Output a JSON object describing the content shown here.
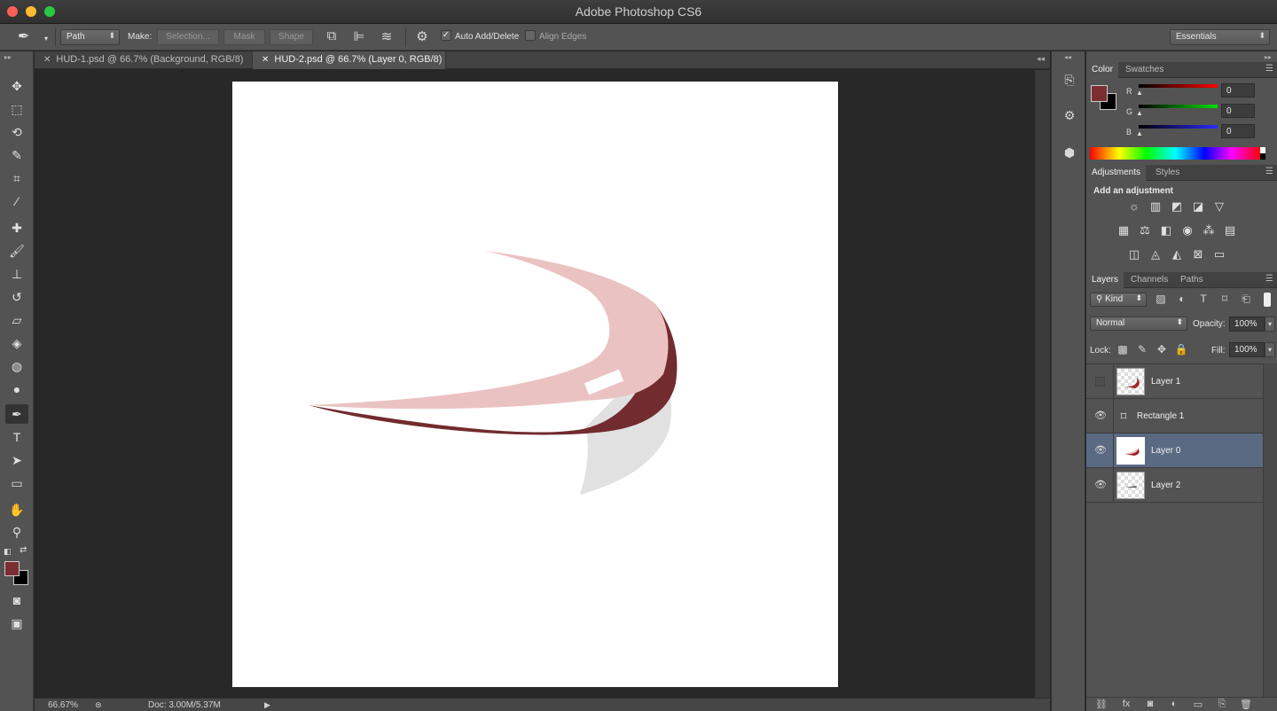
{
  "window": {
    "title": "Adobe Photoshop CS6"
  },
  "options_bar": {
    "mode_select": "Path",
    "make_label": "Make:",
    "selection_button": "Selection...",
    "mask_button": "Mask",
    "shape_button": "Shape",
    "auto_add_delete_label": "Auto Add/Delete",
    "auto_add_delete_checked": "✓",
    "align_edges_label": "Align Edges",
    "workspace_select": "Essentials"
  },
  "doc_tabs": [
    {
      "label": "HUD-1.psd @ 66.7% (Background, RGB/8)",
      "active": false
    },
    {
      "label": "HUD-2.psd @ 66.7% (Layer 0, RGB/8)",
      "active": true
    }
  ],
  "canvas_colors": {
    "pink": "#ebc2c2",
    "maroon": "#722b2e",
    "shadow": "#e1e1e1"
  },
  "status_bar": {
    "zoom": "66.67%",
    "doc_info": "Doc: 3.00M/5.37M"
  },
  "color_panel": {
    "tabs": [
      "Color",
      "Swatches"
    ],
    "foreground": "#7a2e31",
    "background": "#000000",
    "channels": [
      {
        "label": "R",
        "value": "0"
      },
      {
        "label": "G",
        "value": "0"
      },
      {
        "label": "B",
        "value": "0"
      }
    ]
  },
  "adjustments_panel": {
    "tabs": [
      "Adjustments",
      "Styles"
    ],
    "title": "Add an adjustment"
  },
  "layers_panel": {
    "tabs": [
      "Layers",
      "Channels",
      "Paths"
    ],
    "filter_kind": "Kind",
    "blend_mode": "Normal",
    "opacity_label": "Opacity:",
    "opacity_value": "100%",
    "lock_label": "Lock:",
    "fill_label": "Fill:",
    "fill_value": "100%",
    "layers": [
      {
        "name": "Layer 1",
        "visible": false,
        "selected": false
      },
      {
        "name": "Rectangle 1",
        "visible": true,
        "selected": false
      },
      {
        "name": "Layer 0",
        "visible": true,
        "selected": true
      },
      {
        "name": "Layer 2",
        "visible": true,
        "selected": false
      }
    ]
  }
}
